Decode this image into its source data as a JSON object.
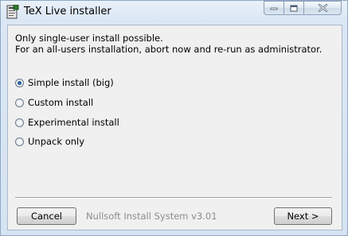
{
  "window": {
    "title": "TeX Live installer",
    "icons": [
      "tex-live-app-icon",
      "minimize-icon",
      "maximize-icon",
      "close-icon"
    ]
  },
  "message": {
    "line1": "Only single-user install possible.",
    "line2": "For an all-users installation, abort now and re-run as administrator."
  },
  "options": [
    {
      "label": "Simple install (big)",
      "checked": true
    },
    {
      "label": "Custom install",
      "checked": false
    },
    {
      "label": "Experimental install",
      "checked": false
    },
    {
      "label": "Unpack only",
      "checked": false
    }
  ],
  "footer": {
    "branding": "Nullsoft Install System v3.01",
    "cancel_label": "Cancel",
    "next_label": "Next >"
  }
}
